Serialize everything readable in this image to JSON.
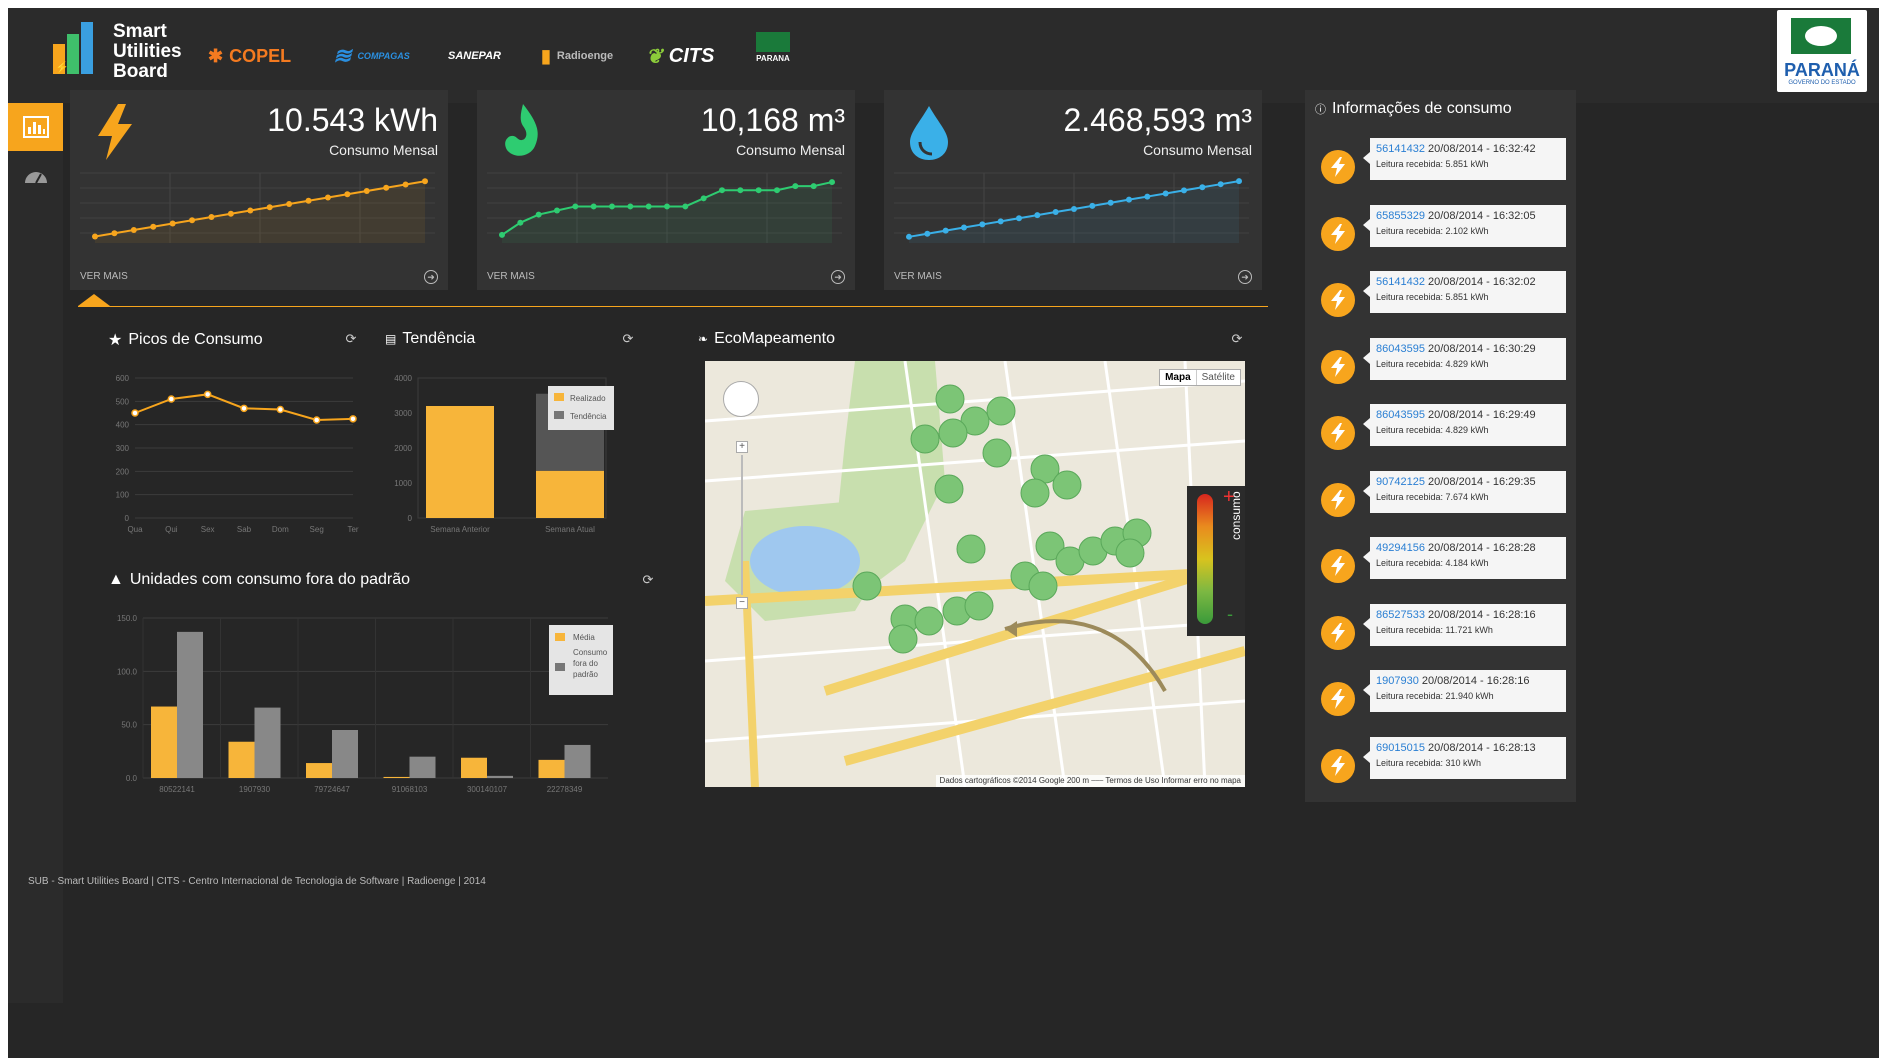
{
  "header": {
    "brand": [
      "Smart",
      "Utilities",
      "Board"
    ],
    "partners": [
      "COPEL",
      "COMPAGAS",
      "SANEPAR",
      "Radioenge",
      "CITS",
      "PARANA"
    ],
    "gov_label": "PARANÁ",
    "gov_sub": "GOVERNO DO ESTADO"
  },
  "cards": [
    {
      "value": "10.543 kWh",
      "label": "Consumo Mensal",
      "more": "VER MAIS",
      "icon": "lightning-icon",
      "color": "#f7a51d",
      "series": [
        2,
        3,
        4,
        5,
        6,
        7,
        8,
        9,
        10,
        11,
        12,
        13,
        14,
        15,
        16,
        17,
        18,
        19
      ]
    },
    {
      "value": "10,168 m³",
      "label": "Consumo Mensal",
      "more": "VER MAIS",
      "icon": "gas-flame-icon",
      "color": "#2ecc71",
      "series": [
        2,
        5,
        7,
        8,
        9,
        9,
        9,
        9,
        9,
        9,
        9,
        11,
        13,
        13,
        13,
        13,
        14,
        14,
        15
      ]
    },
    {
      "value": "2.468,593 m³",
      "label": "Consumo Mensal",
      "more": "VER MAIS",
      "icon": "water-drop-icon",
      "color": "#3ab0e8",
      "series": [
        2,
        3,
        4,
        5,
        6,
        7,
        8,
        9,
        10,
        11,
        12,
        13,
        14,
        15,
        16,
        17,
        18,
        19,
        20
      ]
    }
  ],
  "panels": {
    "picos": "Picos de Consumo",
    "tendencia": "Tendência",
    "eco": "EcoMapeamento",
    "unidades": "Unidades com consumo fora do padrão"
  },
  "chart_data": [
    {
      "type": "line",
      "title": "Picos de Consumo",
      "categories": [
        "Qua",
        "Qui",
        "Sex",
        "Sab",
        "Dom",
        "Seg",
        "Ter"
      ],
      "values": [
        450,
        510,
        530,
        470,
        465,
        420,
        425
      ],
      "ylim": [
        0,
        600
      ],
      "yticks": [
        0,
        100,
        200,
        300,
        400,
        500,
        600
      ]
    },
    {
      "type": "bar",
      "title": "Tendência",
      "categories": [
        "Semana Anterior",
        "Semana Atual"
      ],
      "series": [
        {
          "name": "Realizado",
          "values": [
            3200,
            1350
          ]
        },
        {
          "name": "Tendência",
          "values": [
            0,
            2200
          ]
        }
      ],
      "ylim": [
        0,
        4000
      ],
      "yticks": [
        0,
        1000,
        2000,
        3000,
        4000
      ]
    },
    {
      "type": "bar",
      "title": "Unidades com consumo fora do padrão",
      "categories": [
        "80522141",
        "1907930",
        "79724647",
        "91068103",
        "300140107",
        "22278349"
      ],
      "series": [
        {
          "name": "Média",
          "values": [
            67,
            34,
            14,
            1,
            19,
            17
          ]
        },
        {
          "name": "Consumo fora do padrão",
          "values": [
            137,
            66,
            45,
            20,
            2,
            31
          ]
        }
      ],
      "ylim": [
        0,
        150
      ],
      "yticks": [
        "0.0",
        "50.0",
        "100.0",
        "150.0"
      ]
    }
  ],
  "legend_tendencia": [
    "Realizado",
    "Tendência"
  ],
  "legend_unidades": [
    "Média",
    "Consumo fora do padrão"
  ],
  "map": {
    "btn_map": "Mapa",
    "btn_sat": "Satélite",
    "scale_label": "consumo",
    "plus": "+",
    "minus": "-",
    "attribution": "Dados cartográficos ©2014 Google  200 m ⎯⎯⎯  Termos de Uso  Informar erro no mapa"
  },
  "info": {
    "title": "Informações de consumo",
    "items": [
      {
        "id": "56141432",
        "date": "20/08/2014 - 16:32:42",
        "reading": "Leitura recebida: 5.851 kWh"
      },
      {
        "id": "65855329",
        "date": "20/08/2014 - 16:32:05",
        "reading": "Leitura recebida: 2.102 kWh"
      },
      {
        "id": "56141432",
        "date": "20/08/2014 - 16:32:02",
        "reading": "Leitura recebida: 5.851 kWh"
      },
      {
        "id": "86043595",
        "date": "20/08/2014 - 16:30:29",
        "reading": "Leitura recebida: 4.829 kWh"
      },
      {
        "id": "86043595",
        "date": "20/08/2014 - 16:29:49",
        "reading": "Leitura recebida: 4.829 kWh"
      },
      {
        "id": "90742125",
        "date": "20/08/2014 - 16:29:35",
        "reading": "Leitura recebida: 7.674 kWh"
      },
      {
        "id": "49294156",
        "date": "20/08/2014 - 16:28:28",
        "reading": "Leitura recebida: 4.184 kWh"
      },
      {
        "id": "86527533",
        "date": "20/08/2014 - 16:28:16",
        "reading": "Leitura recebida: 11.721 kWh"
      },
      {
        "id": "1907930",
        "date": "20/08/2014 - 16:28:16",
        "reading": "Leitura recebida: 21.940 kWh"
      },
      {
        "id": "69015015",
        "date": "20/08/2014 - 16:28:13",
        "reading": "Leitura recebida: 310 kWh"
      }
    ]
  },
  "footer": "SUB - Smart Utilities Board | CITS - Centro Internacional de Tecnologia de Software | Radioenge | 2014"
}
